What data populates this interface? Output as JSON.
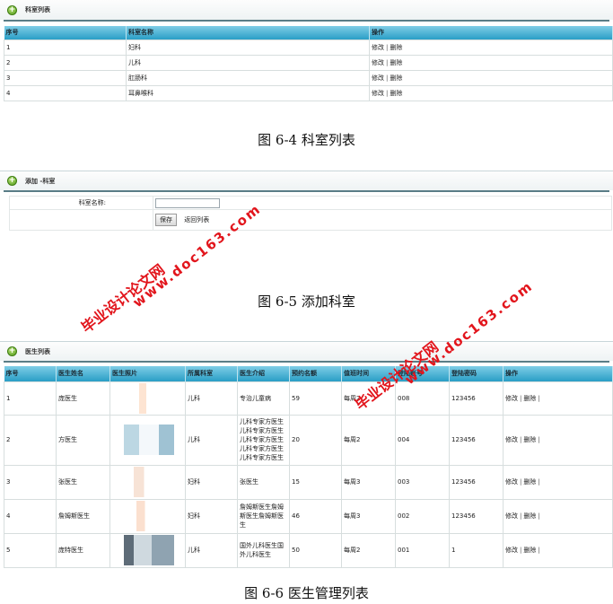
{
  "dept_list": {
    "title": "科室列表",
    "headers": [
      "序号",
      "科室名称",
      "操作"
    ],
    "rows": [
      {
        "id": "1",
        "name": "妇科",
        "edit": "修改",
        "sep": "|",
        "del": "删除"
      },
      {
        "id": "2",
        "name": "儿科",
        "edit": "修改",
        "sep": "|",
        "del": "删除"
      },
      {
        "id": "3",
        "name": "肛肠科",
        "edit": "修改",
        "sep": "|",
        "del": "删除"
      },
      {
        "id": "4",
        "name": "耳鼻喉科",
        "edit": "修改",
        "sep": "|",
        "del": "删除"
      }
    ]
  },
  "caption1": "图 6-4  科室列表",
  "add_dept": {
    "title": "添加 -科室",
    "field_label": "科室名称:",
    "field_value": "",
    "save_label": "保存",
    "back_label": "返回列表"
  },
  "caption2": "图 6-5  添加科室",
  "doctor_list": {
    "title": "医生列表",
    "headers": [
      "序号",
      "医生姓名",
      "医生照片",
      "所属科室",
      "医生介绍",
      "预约名额",
      "值班时间",
      "登陆账号",
      "登陆密码",
      "操作"
    ],
    "rows": [
      {
        "id": "1",
        "name": "庞医生",
        "dept": "儿科",
        "intro": "专治儿童病",
        "quota": "59",
        "duty": "每周2",
        "account": "008",
        "password": "123456",
        "edit": "修改",
        "sep": "|",
        "del": "删除",
        "sep2": "|"
      },
      {
        "id": "2",
        "name": "方医生",
        "dept": "儿科",
        "intro": "儿科专家方医生儿科专家方医生儿科专家方医生儿科专家方医生儿科专家方医生",
        "quota": "20",
        "duty": "每周2",
        "account": "004",
        "password": "123456",
        "edit": "修改",
        "sep": "|",
        "del": "删除",
        "sep2": "|"
      },
      {
        "id": "3",
        "name": "张医生",
        "dept": "妇科",
        "intro": "张医生",
        "quota": "15",
        "duty": "每周3",
        "account": "003",
        "password": "123456",
        "edit": "修改",
        "sep": "|",
        "del": "删除",
        "sep2": "|"
      },
      {
        "id": "4",
        "name": "詹姆斯医生",
        "dept": "妇科",
        "intro": "詹姆斯医生詹姆斯医生詹姆斯医生",
        "quota": "46",
        "duty": "每周3",
        "account": "002",
        "password": "123456",
        "edit": "修改",
        "sep": "|",
        "del": "删除",
        "sep2": "|"
      },
      {
        "id": "5",
        "name": "庞特医生",
        "dept": "儿科",
        "intro": "国外儿科医生国外儿科医生",
        "quota": "50",
        "duty": "每周2",
        "account": "001",
        "password": "1",
        "edit": "修改",
        "sep": "|",
        "del": "删除",
        "sep2": "|"
      }
    ]
  },
  "caption3": "图 6-6  医生管理列表",
  "watermarks": {
    "line1": "毕业设计论文网",
    "line2": "www.doc163.com"
  },
  "colors": {
    "header_top": "#7fcde6",
    "header_bottom": "#2a9ec6",
    "watermark": "#e2151c",
    "plus_icon": "#4e9a16"
  }
}
